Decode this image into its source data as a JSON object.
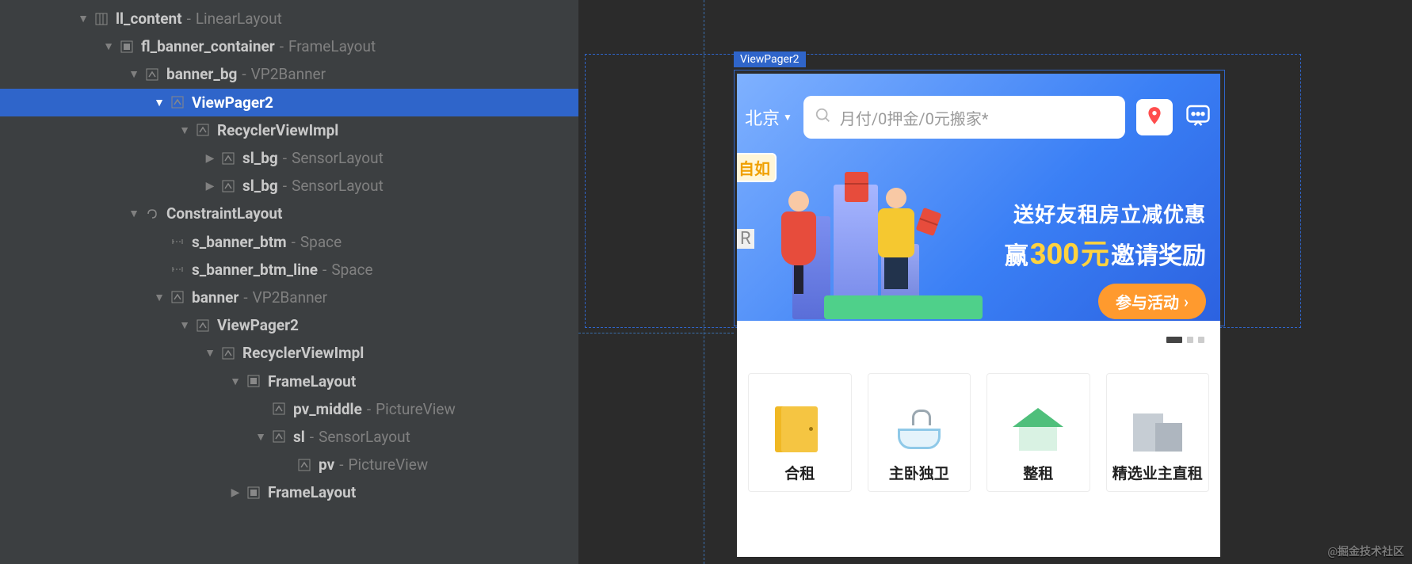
{
  "tree": [
    {
      "indent": 96,
      "ch": "down",
      "icon": "vlinear",
      "id": "ll_content",
      "type": "LinearLayout"
    },
    {
      "indent": 128,
      "ch": "down",
      "icon": "frame",
      "id": "fl_banner_container",
      "type": "FrameLayout"
    },
    {
      "indent": 160,
      "ch": "down",
      "icon": "custom",
      "id": "banner_bg",
      "type": "VP2Banner"
    },
    {
      "indent": 192,
      "ch": "down",
      "icon": "custom",
      "id": "",
      "type": "ViewPager2",
      "selected": true
    },
    {
      "indent": 224,
      "ch": "down",
      "icon": "custom",
      "id": "",
      "type": "RecyclerViewImpl"
    },
    {
      "indent": 256,
      "ch": "right",
      "icon": "custom",
      "id": "sl_bg",
      "type": "SensorLayout"
    },
    {
      "indent": 256,
      "ch": "right",
      "icon": "custom",
      "id": "sl_bg",
      "type": "SensorLayout"
    },
    {
      "indent": 160,
      "ch": "down",
      "icon": "constraint",
      "id": "",
      "type": "ConstraintLayout"
    },
    {
      "indent": 192,
      "ch": "",
      "icon": "space",
      "id": "s_banner_btm",
      "type": "Space"
    },
    {
      "indent": 192,
      "ch": "",
      "icon": "space",
      "id": "s_banner_btm_line",
      "type": "Space"
    },
    {
      "indent": 192,
      "ch": "down",
      "icon": "custom",
      "id": "banner",
      "type": "VP2Banner"
    },
    {
      "indent": 224,
      "ch": "down",
      "icon": "custom",
      "id": "",
      "type": "ViewPager2"
    },
    {
      "indent": 256,
      "ch": "down",
      "icon": "custom",
      "id": "",
      "type": "RecyclerViewImpl"
    },
    {
      "indent": 288,
      "ch": "down",
      "icon": "frame",
      "id": "",
      "type": "FrameLayout"
    },
    {
      "indent": 320,
      "ch": "",
      "icon": "custom",
      "id": "pv_middle",
      "type": "PictureView"
    },
    {
      "indent": 320,
      "ch": "down",
      "icon": "custom",
      "id": "sl",
      "type": "SensorLayout"
    },
    {
      "indent": 352,
      "ch": "",
      "icon": "custom",
      "id": "pv",
      "type": "PictureView"
    },
    {
      "indent": 288,
      "ch": "right",
      "icon": "frame",
      "id": "",
      "type": "FrameLayout"
    }
  ],
  "selection_label": "ViewPager2",
  "app": {
    "city": "北京",
    "search_placeholder": "月付/0押金/0元搬家*",
    "brand": "自如",
    "brand_r": "R",
    "promo_line1": "送好友租房立减优惠",
    "promo_zhuan": "赢",
    "promo_amount": "300",
    "promo_unit": "元",
    "promo_rest": "邀请奖励",
    "cta": "参与活动",
    "tiles": [
      "合租",
      "主卧独卫",
      "整租",
      "精选业主直租"
    ]
  },
  "watermark": "@掘金技术社区"
}
